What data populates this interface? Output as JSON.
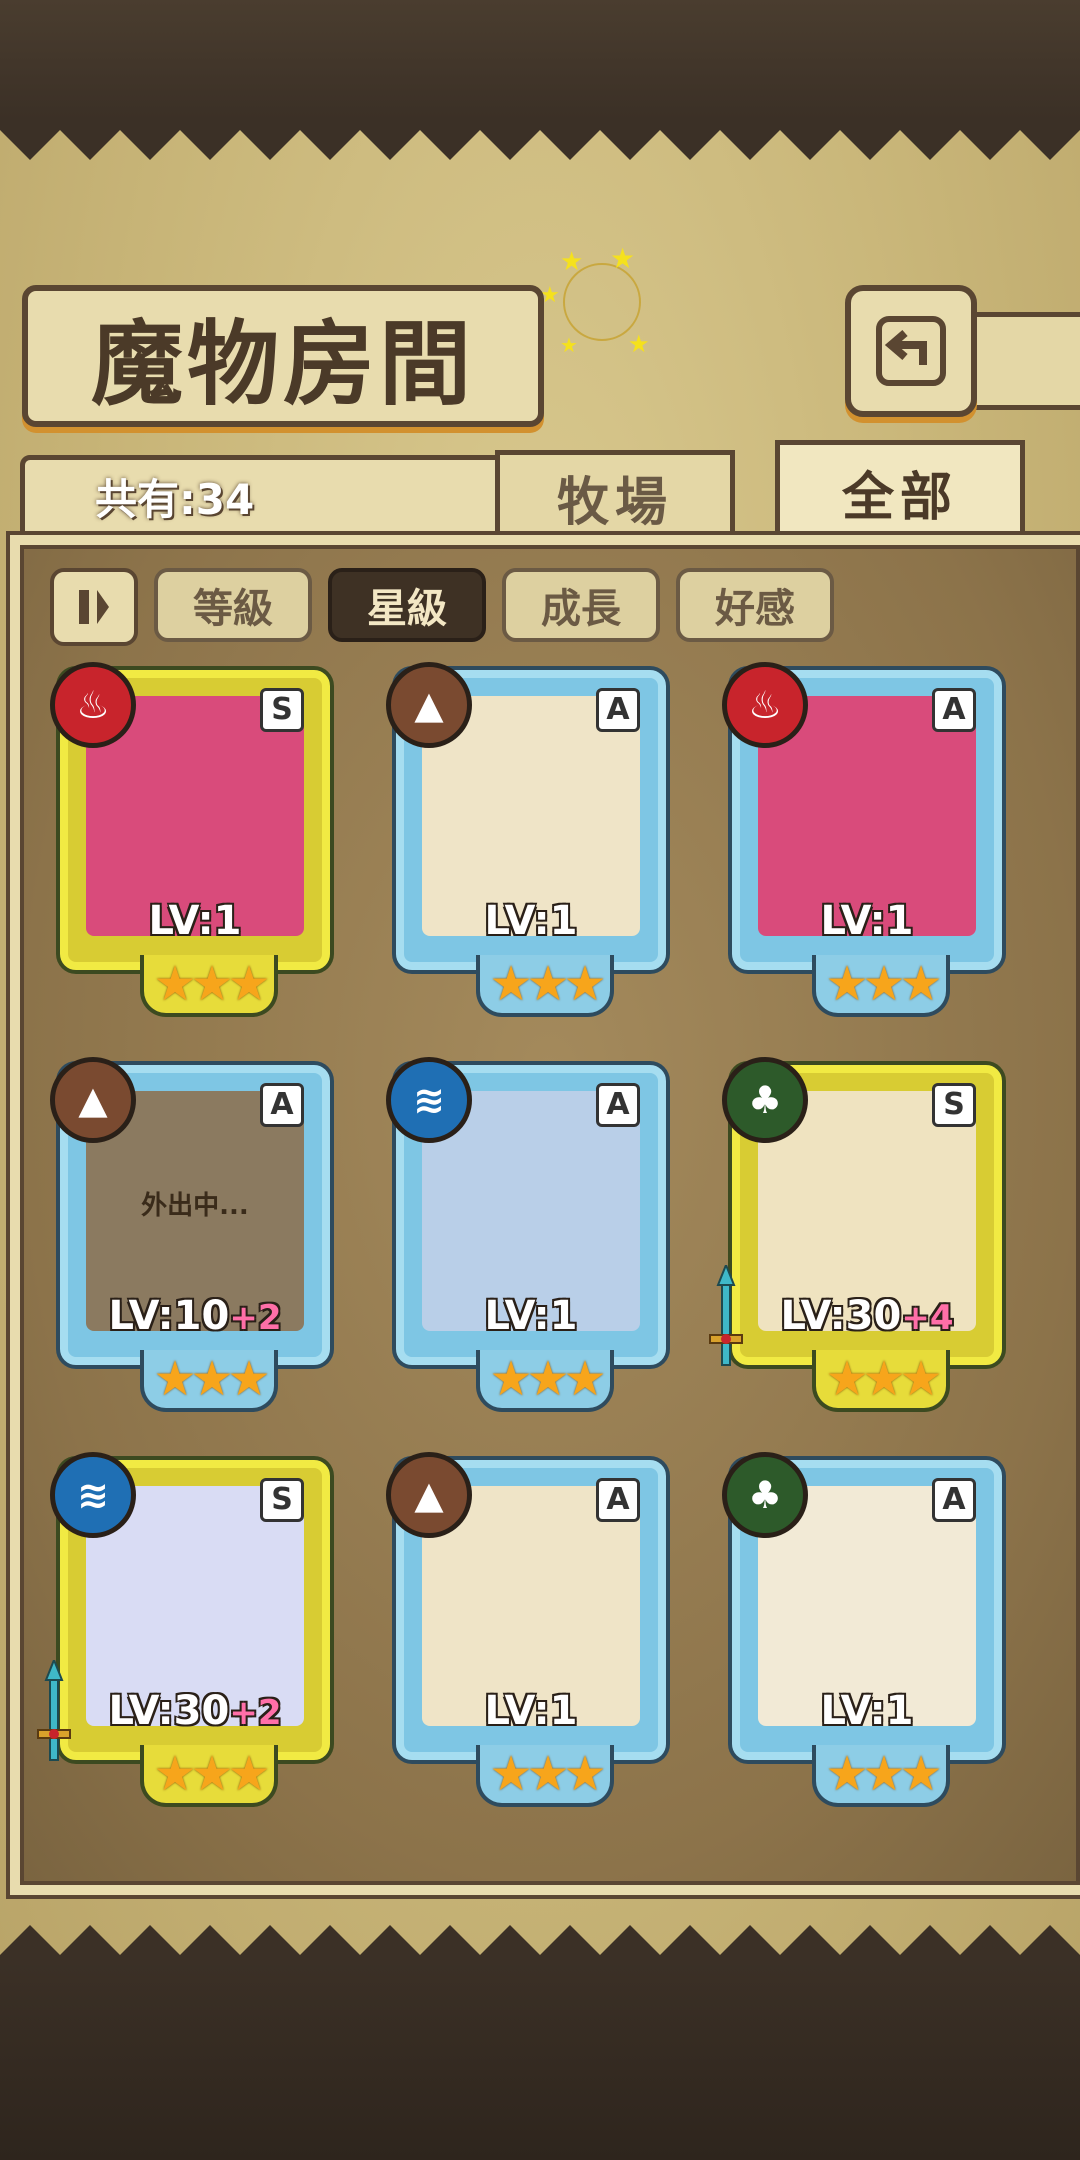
{
  "header": {
    "title": "魔物房間",
    "back_icon": "back-arrow-icon"
  },
  "summary": {
    "count_label": "共有:34"
  },
  "tabs": [
    {
      "label": "牧場",
      "active": false
    },
    {
      "label": "全部",
      "active": true
    }
  ],
  "filters": {
    "sort_icon": "pause-sort-icon",
    "chips": [
      {
        "label": "等級",
        "active": false
      },
      {
        "label": "星級",
        "active": true
      },
      {
        "label": "成長",
        "active": false
      },
      {
        "label": "好感",
        "active": false
      }
    ]
  },
  "monsters": [
    {
      "element": "fire",
      "element_color": "#c8242c",
      "rank": "S",
      "frame": "gold",
      "lv": "LV:1",
      "plus": "",
      "stars": "★★★",
      "portrait_bg": "#d94b7b",
      "status": "",
      "equipped": false
    },
    {
      "element": "earth",
      "element_color": "#7a4a30",
      "rank": "A",
      "frame": "blue",
      "lv": "LV:1",
      "plus": "",
      "stars": "★★★",
      "portrait_bg": "#efe4c7",
      "status": "",
      "equipped": false
    },
    {
      "element": "fire",
      "element_color": "#c8242c",
      "rank": "A",
      "frame": "blue",
      "lv": "LV:1",
      "plus": "",
      "stars": "★★★",
      "portrait_bg": "#d94b7b",
      "status": "",
      "equipped": false
    },
    {
      "element": "earth",
      "element_color": "#7a4a30",
      "rank": "A",
      "frame": "blue",
      "lv": "LV:10",
      "plus": "+2",
      "stars": "★★★",
      "portrait_bg": "#8b7a60",
      "status": "外出中...",
      "equipped": false
    },
    {
      "element": "water",
      "element_color": "#1f6fb4",
      "rank": "A",
      "frame": "blue",
      "lv": "LV:1",
      "plus": "",
      "stars": "★★★",
      "portrait_bg": "#b9cfe8",
      "status": "",
      "equipped": false
    },
    {
      "element": "wood",
      "element_color": "#2d5a2a",
      "rank": "S",
      "frame": "gold",
      "lv": "LV:30",
      "plus": "+4",
      "stars": "★★★",
      "portrait_bg": "#efe3c0",
      "status": "",
      "equipped": true
    },
    {
      "element": "water",
      "element_color": "#1f6fb4",
      "rank": "S",
      "frame": "gold",
      "lv": "LV:30",
      "plus": "+2",
      "stars": "★★★",
      "portrait_bg": "#d9dcf4",
      "status": "",
      "equipped": true
    },
    {
      "element": "earth",
      "element_color": "#7a4a30",
      "rank": "A",
      "frame": "blue",
      "lv": "LV:1",
      "plus": "",
      "stars": "★★★",
      "portrait_bg": "#efe4c7",
      "status": "",
      "equipped": false
    },
    {
      "element": "wood",
      "element_color": "#2d5a2a",
      "rank": "A",
      "frame": "blue",
      "lv": "LV:1",
      "plus": "",
      "stars": "★★★",
      "portrait_bg": "#f2ead6",
      "status": "",
      "equipped": false
    }
  ]
}
